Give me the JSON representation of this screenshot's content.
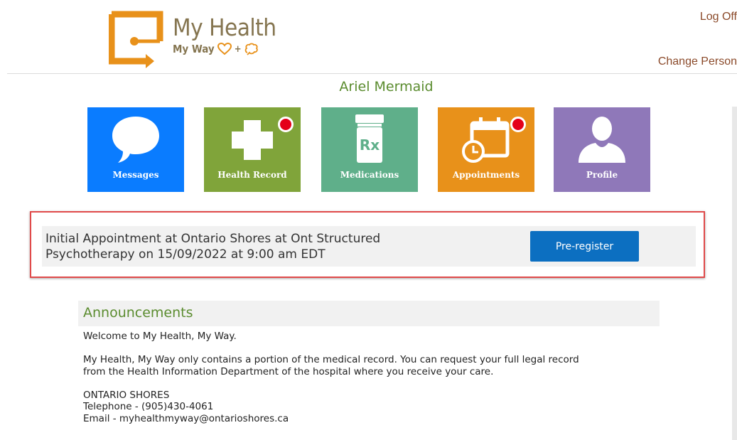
{
  "header": {
    "logo_title": "My Health",
    "logo_subtitle": "My Way",
    "logoff_label": "Log Off",
    "change_person_label": "Change Person"
  },
  "patient": {
    "name": "Ariel Mermaid"
  },
  "tiles": [
    {
      "label": "Messages",
      "icon": "speech-bubble-icon",
      "color": "#0a7cff",
      "notification": false
    },
    {
      "label": "Health Record",
      "icon": "medical-cross-icon",
      "color": "#80a43a",
      "notification": true
    },
    {
      "label": "Medications",
      "icon": "rx-bottle-icon",
      "color": "#5faf8a",
      "notification": false
    },
    {
      "label": "Appointments",
      "icon": "calendar-clock-icon",
      "color": "#e8911a",
      "notification": true
    },
    {
      "label": "Profile",
      "icon": "person-icon",
      "color": "#8f78b9",
      "notification": false
    }
  ],
  "appointment_banner": {
    "text_line1": "Initial Appointment at Ontario Shores at Ont Structured",
    "text_line2": "Psychotherapy on 15/09/2022 at 9:00 am EDT",
    "button_label": "Pre-register"
  },
  "announcements": {
    "title": "Announcements",
    "welcome": "Welcome to My Health, My Way.",
    "para1_line1": "My Health, My Way only contains a portion of the medical record. You can request your full legal record",
    "para1_line2": "from the Health Information Department of the hospital where you receive your care.",
    "org": "ONTARIO SHORES",
    "telephone": "Telephone - (905)430-4061",
    "email": "Email - myhealthmyway@ontarioshores.ca"
  },
  "colors": {
    "brand_brown": "#857550",
    "brand_orange": "#e8911a",
    "accent_green": "#5b8c2f",
    "link_brown": "#8b4a2a",
    "button_blue": "#0c6fc1",
    "highlight_red": "#e04a4a",
    "notification_red": "#e4001a"
  }
}
